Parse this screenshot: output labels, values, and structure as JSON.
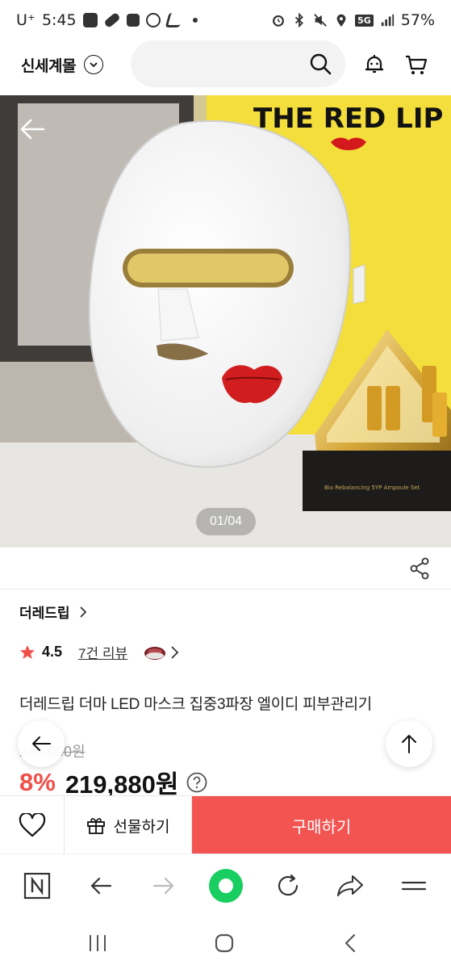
{
  "status_bar": {
    "carrier": "U⁺",
    "time": "5:45",
    "network": "5G",
    "battery": "57%"
  },
  "header": {
    "brand": "신세계몰",
    "search_placeholder": ""
  },
  "hero": {
    "pager": "01/04",
    "image_text": "THE RED LIP",
    "box_text_1": "Bio Rebalancing 5YP Ampoule Set"
  },
  "product": {
    "brand_link": "더레드립",
    "rating": "4.5",
    "review_count": "7건 리뷰",
    "title": "더레드립 더마 LED 마스크 집중3파장 엘이디 피부관리기",
    "original_price": "2​39,000원",
    "discount": "8%",
    "price": "219,880원"
  },
  "purchase_bar": {
    "gift_label": "선물하기",
    "buy_label": "구매하기"
  },
  "colors": {
    "accent_red": "#f25452",
    "discount_red": "#f0504a",
    "browser_green": "#19ce60"
  },
  "icons": {
    "back": "arrow-left-icon",
    "search": "search-icon",
    "alert": "bell-icon",
    "cart": "cart-icon",
    "share": "share-icon",
    "wish": "heart-icon",
    "gift": "gift-icon"
  }
}
